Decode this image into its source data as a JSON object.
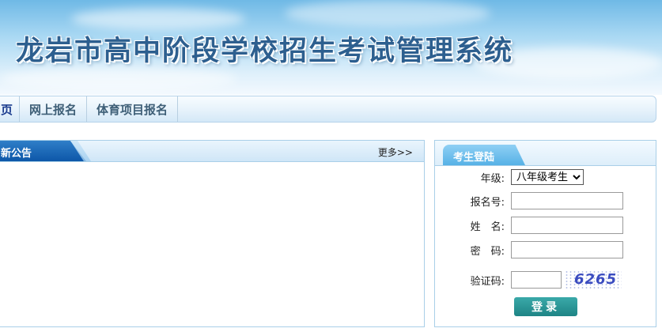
{
  "header": {
    "title": "龙岩市高中阶段学校招生考试管理系统"
  },
  "nav": {
    "items": [
      "页",
      "网上报名",
      "体育项目报名"
    ]
  },
  "news": {
    "title": "新公告",
    "more": "更多>>"
  },
  "login": {
    "tab_label": "考生登陆",
    "grade_label": "年级:",
    "grade_selected": "八年级考生",
    "regno_label": "报名号:",
    "name_label": "姓　名:",
    "password_label": "密　码:",
    "captcha_label": "验证码:",
    "captcha_code": "6265",
    "submit_label": "登录"
  }
}
